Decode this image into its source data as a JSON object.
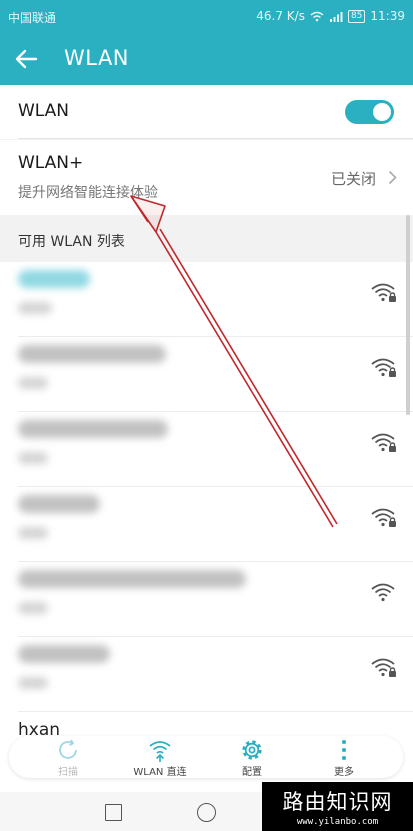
{
  "status_bar": {
    "carrier": "中国联通",
    "speed": "46.7 K/s",
    "battery": "85",
    "time": "11:39"
  },
  "app_bar": {
    "title": "WLAN"
  },
  "wlan_toggle": {
    "label": "WLAN",
    "enabled": true
  },
  "wlan_plus": {
    "title": "WLAN+",
    "subtitle": "提升网络智能连接体验",
    "status": "已关闭"
  },
  "section": {
    "title": "可用 WLAN 列表"
  },
  "networks": [
    {
      "name_blurred": true,
      "connected": true,
      "secured": true
    },
    {
      "name_blurred": true,
      "secured": true
    },
    {
      "name_blurred": true,
      "secured": true
    },
    {
      "name_blurred": true,
      "secured": true
    },
    {
      "name_blurred": true,
      "secured": false
    },
    {
      "name_blurred": true,
      "secured": true
    }
  ],
  "partial_network": {
    "name": "hxan"
  },
  "bottom_actions": [
    {
      "label": "扫描",
      "icon": "refresh-icon",
      "enabled": false
    },
    {
      "label": "WLAN 直连",
      "icon": "wifi-direct-icon",
      "enabled": true
    },
    {
      "label": "配置",
      "icon": "gear-icon",
      "enabled": true
    },
    {
      "label": "更多",
      "icon": "more-icon",
      "enabled": true
    }
  ],
  "watermark": {
    "main": "路由知识网",
    "sub": "www.yilanbo.com"
  },
  "colors": {
    "accent": "#2bb0c2",
    "annotation_arrow": "#c0282c"
  }
}
